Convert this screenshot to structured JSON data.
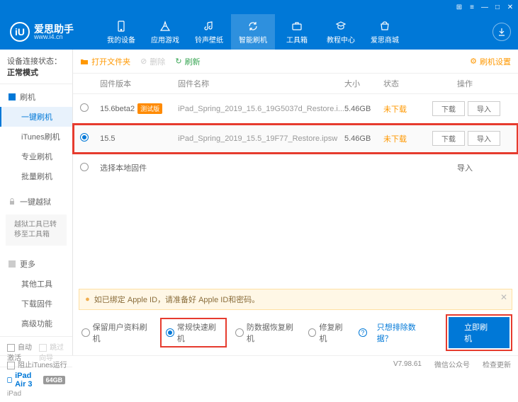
{
  "titlebar": {
    "icons": [
      "⊞",
      "≡",
      "—",
      "□",
      "✕"
    ]
  },
  "brand": {
    "logo_letter": "iU",
    "title": "爱思助手",
    "sub": "www.i4.cn"
  },
  "nav": [
    {
      "key": "device",
      "label": "我的设备"
    },
    {
      "key": "apps",
      "label": "应用游戏"
    },
    {
      "key": "ringtone",
      "label": "铃声壁纸"
    },
    {
      "key": "flash",
      "label": "智能刷机",
      "active": true
    },
    {
      "key": "toolbox",
      "label": "工具箱"
    },
    {
      "key": "tutorial",
      "label": "教程中心"
    },
    {
      "key": "store",
      "label": "爱思商城"
    }
  ],
  "sidebar": {
    "conn_label": "设备连接状态：",
    "conn_value": "正常模式",
    "sec_flash": "刷机",
    "items": [
      "一键刷机",
      "iTunes刷机",
      "专业刷机",
      "批量刷机"
    ],
    "sec_jailbreak": "一键越狱",
    "jailbreak_note": "越狱工具已转移至工具箱",
    "sec_more": "更多",
    "more_items": [
      "其他工具",
      "下载固件",
      "高级功能"
    ],
    "auto_activate": "自动激活",
    "skip_guide": "跳过向导",
    "device_name": "iPad Air 3",
    "device_cap": "64GB",
    "device_type": "iPad"
  },
  "toolbar": {
    "open": "打开文件夹",
    "delete": "删除",
    "refresh": "刷新",
    "settings": "刷机设置"
  },
  "table": {
    "headers": {
      "ver": "固件版本",
      "name": "固件名称",
      "size": "大小",
      "status": "状态",
      "ops": "操作"
    },
    "btn_download": "下载",
    "btn_import": "导入",
    "rows": [
      {
        "ver": "15.6beta2",
        "tag": "测试版",
        "name": "iPad_Spring_2019_15.6_19G5037d_Restore.i...",
        "size": "5.46GB",
        "status": "未下载",
        "selected": false
      },
      {
        "ver": "15.5",
        "tag": "",
        "name": "iPad_Spring_2019_15.5_19F77_Restore.ipsw",
        "size": "5.46GB",
        "status": "未下载",
        "selected": true
      }
    ],
    "local": "选择本地固件"
  },
  "warn": "如已绑定 Apple ID，请准备好 Apple ID和密码。",
  "options": {
    "keep": "保留用户资料刷机",
    "normal": "常规快速刷机",
    "antirec": "防数据恢复刷机",
    "repair": "修复刷机",
    "exclude": "只想排除数据？",
    "flash_btn": "立即刷机"
  },
  "footer": {
    "block": "阻止iTunes运行",
    "version": "V7.98.61",
    "wechat": "微信公众号",
    "update": "检查更新"
  }
}
